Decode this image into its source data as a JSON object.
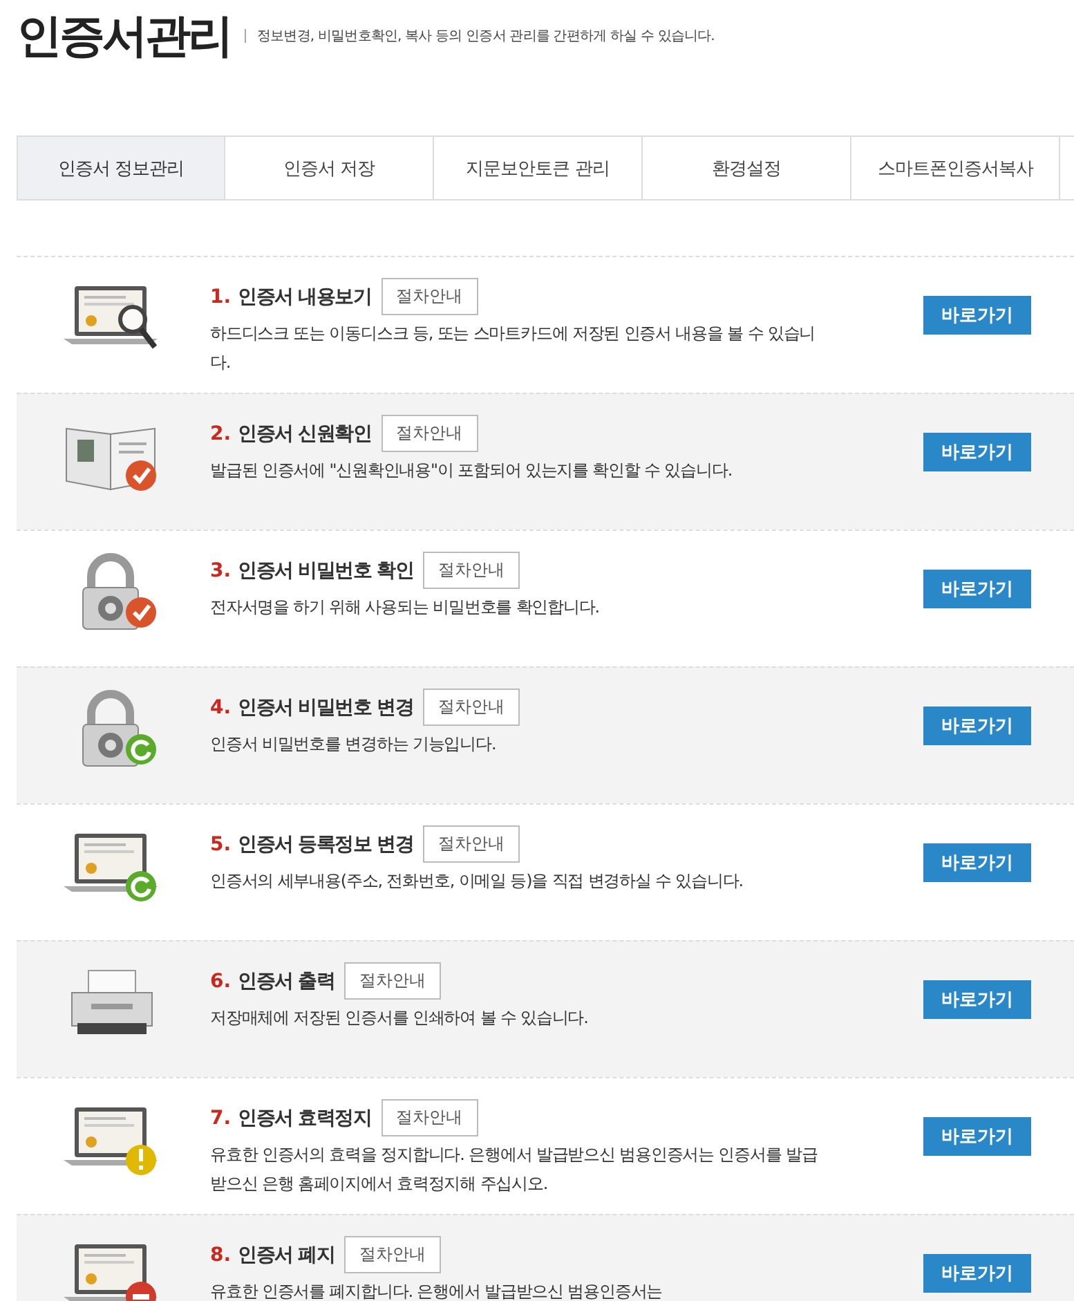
{
  "header": {
    "title": "인증서관리",
    "subtitle": "정보변경, 비밀번호확인, 복사 등의 인증서 관리를 간편하게 하실 수 있습니다."
  },
  "tabs": [
    {
      "label": "인증서 정보관리",
      "selected": true
    },
    {
      "label": "인증서 저장",
      "selected": false
    },
    {
      "label": "지문보안토큰 관리",
      "selected": false
    },
    {
      "label": "환경설정",
      "selected": false
    },
    {
      "label": "스마트폰인증서복사",
      "selected": false
    }
  ],
  "items": [
    {
      "number": "1.",
      "title": "인증서 내용보기",
      "guide": "절차안내",
      "description": "하드디스크 또는 이동디스크 등, 또는 스마트카드에 저장된 인증서 내용을 볼 수 있습니다.",
      "button": "바로가기",
      "kind": "laptop-search"
    },
    {
      "number": "2.",
      "title": "인증서 신원확인",
      "guide": "절차안내",
      "description": "발급된 인증서에 \"신원확인내용\"이 포함되어 있는지를 확인할 수 있습니다.",
      "button": "바로가기",
      "kind": "book-check"
    },
    {
      "number": "3.",
      "title": "인증서 비밀번호 확인",
      "guide": "절차안내",
      "description": "전자서명을 하기 위해 사용되는 비밀번호를 확인합니다.",
      "button": "바로가기",
      "kind": "lock-check"
    },
    {
      "number": "4.",
      "title": "인증서 비밀번호 변경",
      "guide": "절차안내",
      "description": "인증서 비밀번호를 변경하는 기능입니다.",
      "button": "바로가기",
      "kind": "lock-refresh"
    },
    {
      "number": "5.",
      "title": "인증서 등록정보 변경",
      "guide": "절차안내",
      "description": "인증서의 세부내용(주소, 전화번호, 이메일 등)을 직접 변경하실 수 있습니다.",
      "button": "바로가기",
      "kind": "laptop-refresh"
    },
    {
      "number": "6.",
      "title": "인증서 출력",
      "guide": "절차안내",
      "description": "저장매체에 저장된 인증서를 인쇄하여 볼 수 있습니다.",
      "button": "바로가기",
      "kind": "printer"
    },
    {
      "number": "7.",
      "title": "인증서 효력정지",
      "guide": "절차안내",
      "description": "유효한 인증서의 효력을 정지합니다. 은행에서 발급받으신 범용인증서는 인증서를 발급 받으신 은행 홈페이지에서 효력정지해 주십시오.",
      "button": "바로가기",
      "kind": "laptop-alert"
    },
    {
      "number": "8.",
      "title": "인증서 폐지",
      "guide": "절차안내",
      "description": "유효한 인증서를 폐지합니다. 은행에서 발급받으신 범용인증서는",
      "button": "바로가기",
      "kind": "laptop-stop"
    }
  ]
}
